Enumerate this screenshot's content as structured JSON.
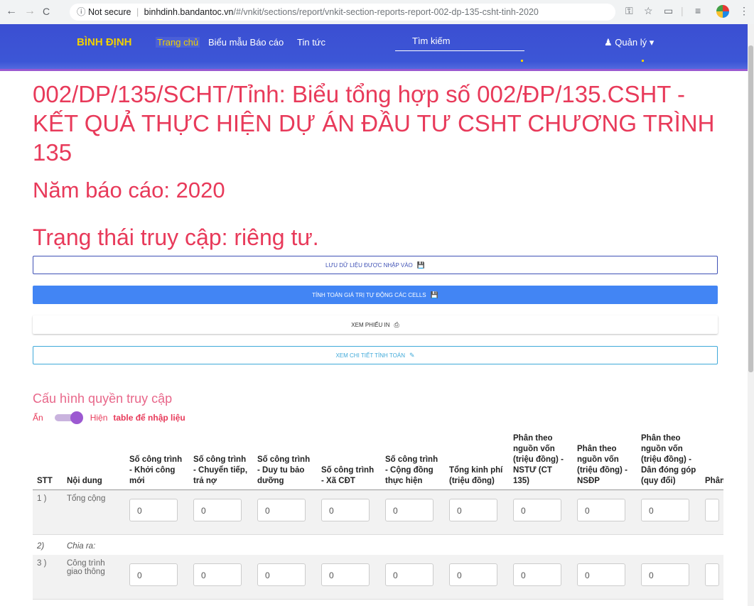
{
  "browser": {
    "nav": [
      "←",
      "→",
      "C"
    ],
    "security": "Not secure",
    "host": "binhdinh.bandantoc.vn",
    "path": "/#/vnkit/sections/report/vnkit-section-reports-report-002-dp-135-csht-tinh-2020"
  },
  "navbar": {
    "brand": "BÌNH ĐỊNH",
    "links": [
      "Trang chủ",
      "Biểu mẫu Báo cáo",
      "Tin tức"
    ],
    "search_placeholder": "Tìm kiếm",
    "user_menu": "Quản lý"
  },
  "page": {
    "title": "002/DP/135/SCHT/Tỉnh: Biểu tổng hợp số 002/ĐP/135.CSHT - KẾT QUẢ THỰC HIỆN DỰ ÁN ĐẦU TƯ CSHT CHƯƠNG TRÌNH 135",
    "year": "Năm báo cáo: 2020",
    "access": "Trạng thái truy cập: riêng tư."
  },
  "buttons": {
    "save": "Lưu dữ liệu được nhập vào",
    "calc": "Tính toán giá trị tự động các cells",
    "print": "Xem phiếu in",
    "detail": "Xem chi tiết tính toán"
  },
  "config": {
    "heading": "Cấu hình quyền truy cập",
    "off_label": "Ẩn",
    "on_label": "Hiện",
    "table_label": "table để nhập liệu",
    "toggle_on": true
  },
  "table": {
    "headers": [
      "STT",
      "Nội dung",
      "Số công trình - Khởi công mới",
      "Số công trình - Chuyển tiếp, trả nợ",
      "Số công trình - Duy tu bảo dưỡng",
      "Số công trình - Xã CĐT",
      "Số công trình - Cộng đồng thực hiện",
      "Tổng kinh phí (triệu đồng)",
      "Phân theo nguồn vốn (triệu đồng) - NSTƯ (CT 135)",
      "Phân theo nguồn vốn (triệu đồng) - NSĐP",
      "Phân theo nguồn vốn (triệu đồng) - Dân đóng góp (quy đổi)",
      "Phân theo nguồn vốn (triệu đồng) - Lồng ghép và khác"
    ],
    "rows": [
      {
        "stt": "1 )",
        "label": "Tổng cộng",
        "values": [
          "0",
          "0",
          "0",
          "0",
          "0",
          "0",
          "0",
          "0",
          "0",
          ""
        ]
      },
      {
        "stt": "2)",
        "label": "Chia ra:",
        "values": []
      },
      {
        "stt": "3 )",
        "label": "Công trình giao thông",
        "values": [
          "0",
          "0",
          "0",
          "0",
          "0",
          "0",
          "0",
          "0",
          "0",
          ""
        ]
      }
    ]
  }
}
